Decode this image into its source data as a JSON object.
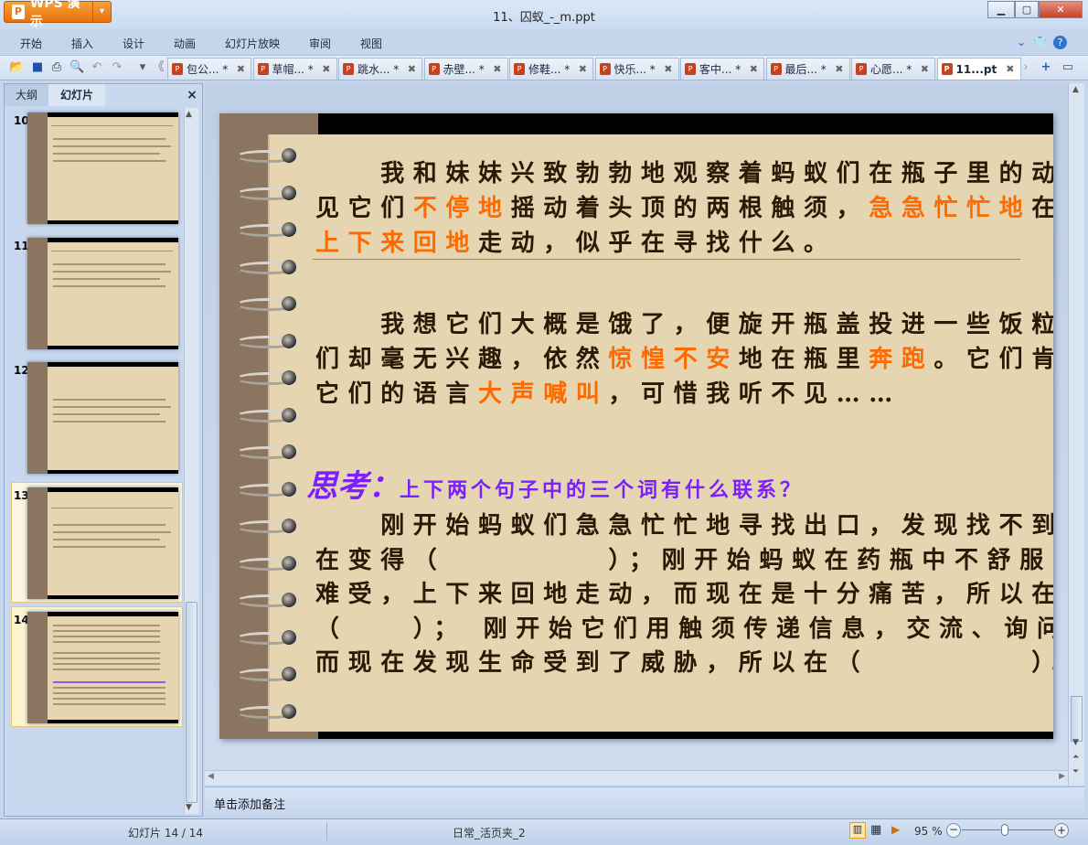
{
  "app": {
    "name": "WPS 演示",
    "title": "11、囚蚁_-_m.ppt"
  },
  "menu": [
    "开始",
    "插入",
    "设计",
    "动画",
    "幻灯片放映",
    "审阅",
    "视图"
  ],
  "tabs": [
    {
      "label": "包公... *"
    },
    {
      "label": "草帽... *"
    },
    {
      "label": "跳水... *"
    },
    {
      "label": "赤壁... *"
    },
    {
      "label": "修鞋... *"
    },
    {
      "label": "快乐... *"
    },
    {
      "label": "客中... *"
    },
    {
      "label": "最后... *"
    },
    {
      "label": "心愿... *"
    },
    {
      "label": "11...pt",
      "active": true
    }
  ],
  "panel": {
    "tabs": [
      "大纲",
      "幻灯片"
    ],
    "close": "×",
    "slides": [
      {
        "n": "10"
      },
      {
        "n": "11"
      },
      {
        "n": "12"
      },
      {
        "n": "13"
      },
      {
        "n": "14",
        "selected": true
      }
    ]
  },
  "slide": {
    "p1": [
      [
        {
          "t": "　　我和妹妹兴致勃勃地观察着蚂蚁们在瓶子里的动静，只"
        }
      ],
      [
        {
          "t": "见它们"
        },
        {
          "t": "不停地",
          "o": 1
        },
        {
          "t": "摇动着头顶的两根触须，"
        },
        {
          "t": "急急忙忙地",
          "o": 1
        },
        {
          "t": "在瓶子里"
        }
      ],
      [
        {
          "t": "上下来回地",
          "o": 1
        },
        {
          "t": "走动，似乎在寻找什么。"
        }
      ]
    ],
    "p2": [
      [
        {
          "t": "　　我想它们大概是饿了，便旋开瓶盖投进一些饭粒，可它"
        }
      ],
      [
        {
          "t": "们却毫无兴趣，依然"
        },
        {
          "t": "惊惶不安",
          "o": 1
        },
        {
          "t": "地在瓶里"
        },
        {
          "t": "奔跑",
          "o": 1
        },
        {
          "t": "。它们肯定在用"
        }
      ],
      [
        {
          "t": "它们的语言"
        },
        {
          "t": "大声喊叫",
          "o": 1
        },
        {
          "t": "，可惜我听不见……"
        }
      ]
    ],
    "think_label": "思考：",
    "think_question": "上下两个句子中的三个词有什么联系？",
    "p3": [
      [
        {
          "t": "　　刚开始蚂蚁们急急忙忙地寻找出口，发现找不到，所以现"
        }
      ],
      [
        {
          "t": "在变得（　　　　　）；刚开始蚂蚁在药瓶中不舒服，很"
        }
      ],
      [
        {
          "t": "难受，上下来回地走动，而现在是十分痛苦，所以在"
        }
      ],
      [
        {
          "t": "（　　）； 刚开始它们用触须传递信息，交流、询问着，"
        }
      ],
      [
        {
          "t": "而现在发现生命受到了威胁，所以在（　　　　　）。"
        }
      ]
    ]
  },
  "notes": "单击添加备注",
  "status": {
    "slide": "幻灯片 14 / 14",
    "template": "日常_活页夹_2",
    "zoom": "95 %"
  },
  "colors": {
    "accent": "#ff6a00",
    "think": "#7a1fff",
    "paper": "#e6d5b1"
  }
}
